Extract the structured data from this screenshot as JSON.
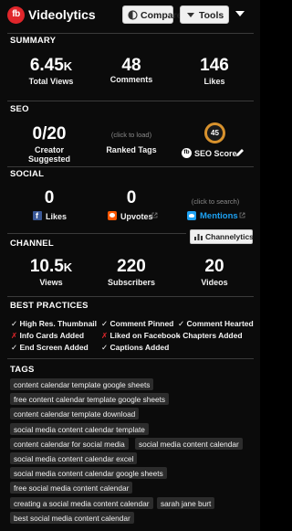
{
  "header": {
    "logo_text": "fb",
    "brand": "Videolytics",
    "compare_label": "Compare",
    "tools_label": "Tools"
  },
  "summary": {
    "title": "SUMMARY",
    "views_value": "6.45",
    "views_unit": "K",
    "views_label": "Total Views",
    "comments_value": "48",
    "comments_label": "Comments",
    "likes_value": "146",
    "likes_label": "Likes"
  },
  "seo": {
    "title": "SEO",
    "creator_value": "0/20",
    "creator_label": "Creator Suggested",
    "ranked_hint": "(click to load)",
    "ranked_label": "Ranked Tags",
    "score_value": "45",
    "score_label": "SEO Score"
  },
  "social": {
    "title": "SOCIAL",
    "likes_value": "0",
    "likes_label": "Likes",
    "upvotes_value": "0",
    "upvotes_label": "Upvotes",
    "search_hint": "(click to search)",
    "mentions_label": "Mentions"
  },
  "channel": {
    "title": "CHANNEL",
    "channelytics_label": "Channelytics",
    "views_value": "10.5",
    "views_unit": "K",
    "views_label": "Views",
    "subs_value": "220",
    "subs_label": "Subscribers",
    "videos_value": "20",
    "videos_label": "Videos"
  },
  "best_practices": {
    "title": "BEST PRACTICES",
    "items": [
      {
        "mark": "✓",
        "text": "High Res. Thumbnail",
        "status": "ok"
      },
      {
        "mark": "✓",
        "text": "Comment Pinned",
        "status": "ok"
      },
      {
        "mark": "✓",
        "text": "Comment Hearted",
        "status": "ok"
      },
      {
        "mark": "✗",
        "text": "Info Cards Added",
        "status": "bad"
      },
      {
        "mark": "✗",
        "text": "Liked on Facebook",
        "status": "bad"
      },
      {
        "mark": "-",
        "text": "Chapters Added",
        "status": "neutral"
      },
      {
        "mark": "✓",
        "text": "End Screen Added",
        "status": "ok"
      },
      {
        "mark": "✓",
        "text": "Captions Added",
        "status": "ok"
      }
    ]
  },
  "tags": {
    "title": "TAGS",
    "items": [
      "content calendar template google sheets",
      "free content calendar template google sheets",
      "content calendar template download",
      "social media content calendar template",
      "content calendar for social media",
      "social media content calendar",
      "social media content calendar excel",
      "social media content calendar google sheets",
      "free social media content calendar",
      "creating a social media content calendar",
      "sarah jane burt",
      "best social media content calendar"
    ]
  },
  "colors": {
    "background": "#0b0b0b",
    "brand_red": "#e0262b",
    "seo_score_ring": "#d8922d",
    "facebook_blue": "#3b5998",
    "reddit_orange": "#ff5700",
    "twitter_blue": "#1da1f2",
    "tag_bg": "#2c2c2c"
  },
  "icons": [
    "logo-icon",
    "compare-icon",
    "tools-chevron-icon",
    "menu-arrow-icon",
    "facebook-icon",
    "reddit-icon",
    "twitter-icon",
    "external-link-icon",
    "pencil-icon",
    "chart-icon"
  ]
}
